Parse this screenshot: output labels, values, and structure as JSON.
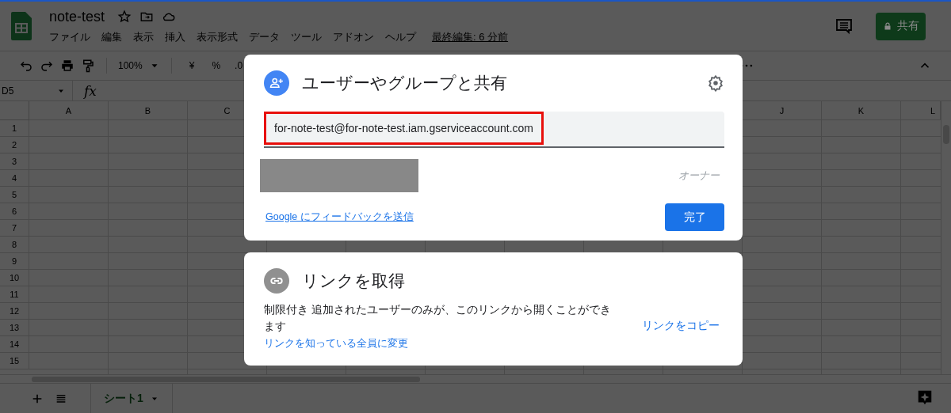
{
  "header": {
    "title": "note-test",
    "menus": [
      "ファイル",
      "編集",
      "表示",
      "挿入",
      "表示形式",
      "データ",
      "ツール",
      "アドオン",
      "ヘルプ"
    ],
    "last_edit": "最終編集: 6 分前",
    "share_button": "共有"
  },
  "toolbar": {
    "zoom": "100%",
    "currency": "¥",
    "percent": "%",
    "decimal": ".0"
  },
  "formula_bar": {
    "cell_ref": "D5",
    "fx": "fx"
  },
  "grid": {
    "columns_left": [
      "A",
      "B",
      "C"
    ],
    "columns_right": [
      "J",
      "K",
      "L"
    ],
    "rows": [
      "1",
      "2",
      "3",
      "4",
      "5",
      "6",
      "7",
      "8",
      "9",
      "10",
      "11",
      "12",
      "13",
      "14",
      "15"
    ]
  },
  "sheet_tabs": [
    {
      "label": "シート1",
      "selected": true
    }
  ],
  "share_dialog": {
    "title": "ユーザーやグループと共有",
    "invite_field": {
      "value": "for-note-test@for-note-test.iam.gserviceaccount.com",
      "highlighted": true
    },
    "owner_role": "オーナー",
    "feedback_link": "Google にフィードバックを送信",
    "done_button": "完了"
  },
  "link_dialog": {
    "title": "リンクを取得",
    "description": "制限付き 追加されたユーザーのみが、このリンクから開くことができます",
    "change_link": "リンクを知っている全員に変更",
    "copy_link": "リンクをコピー"
  }
}
